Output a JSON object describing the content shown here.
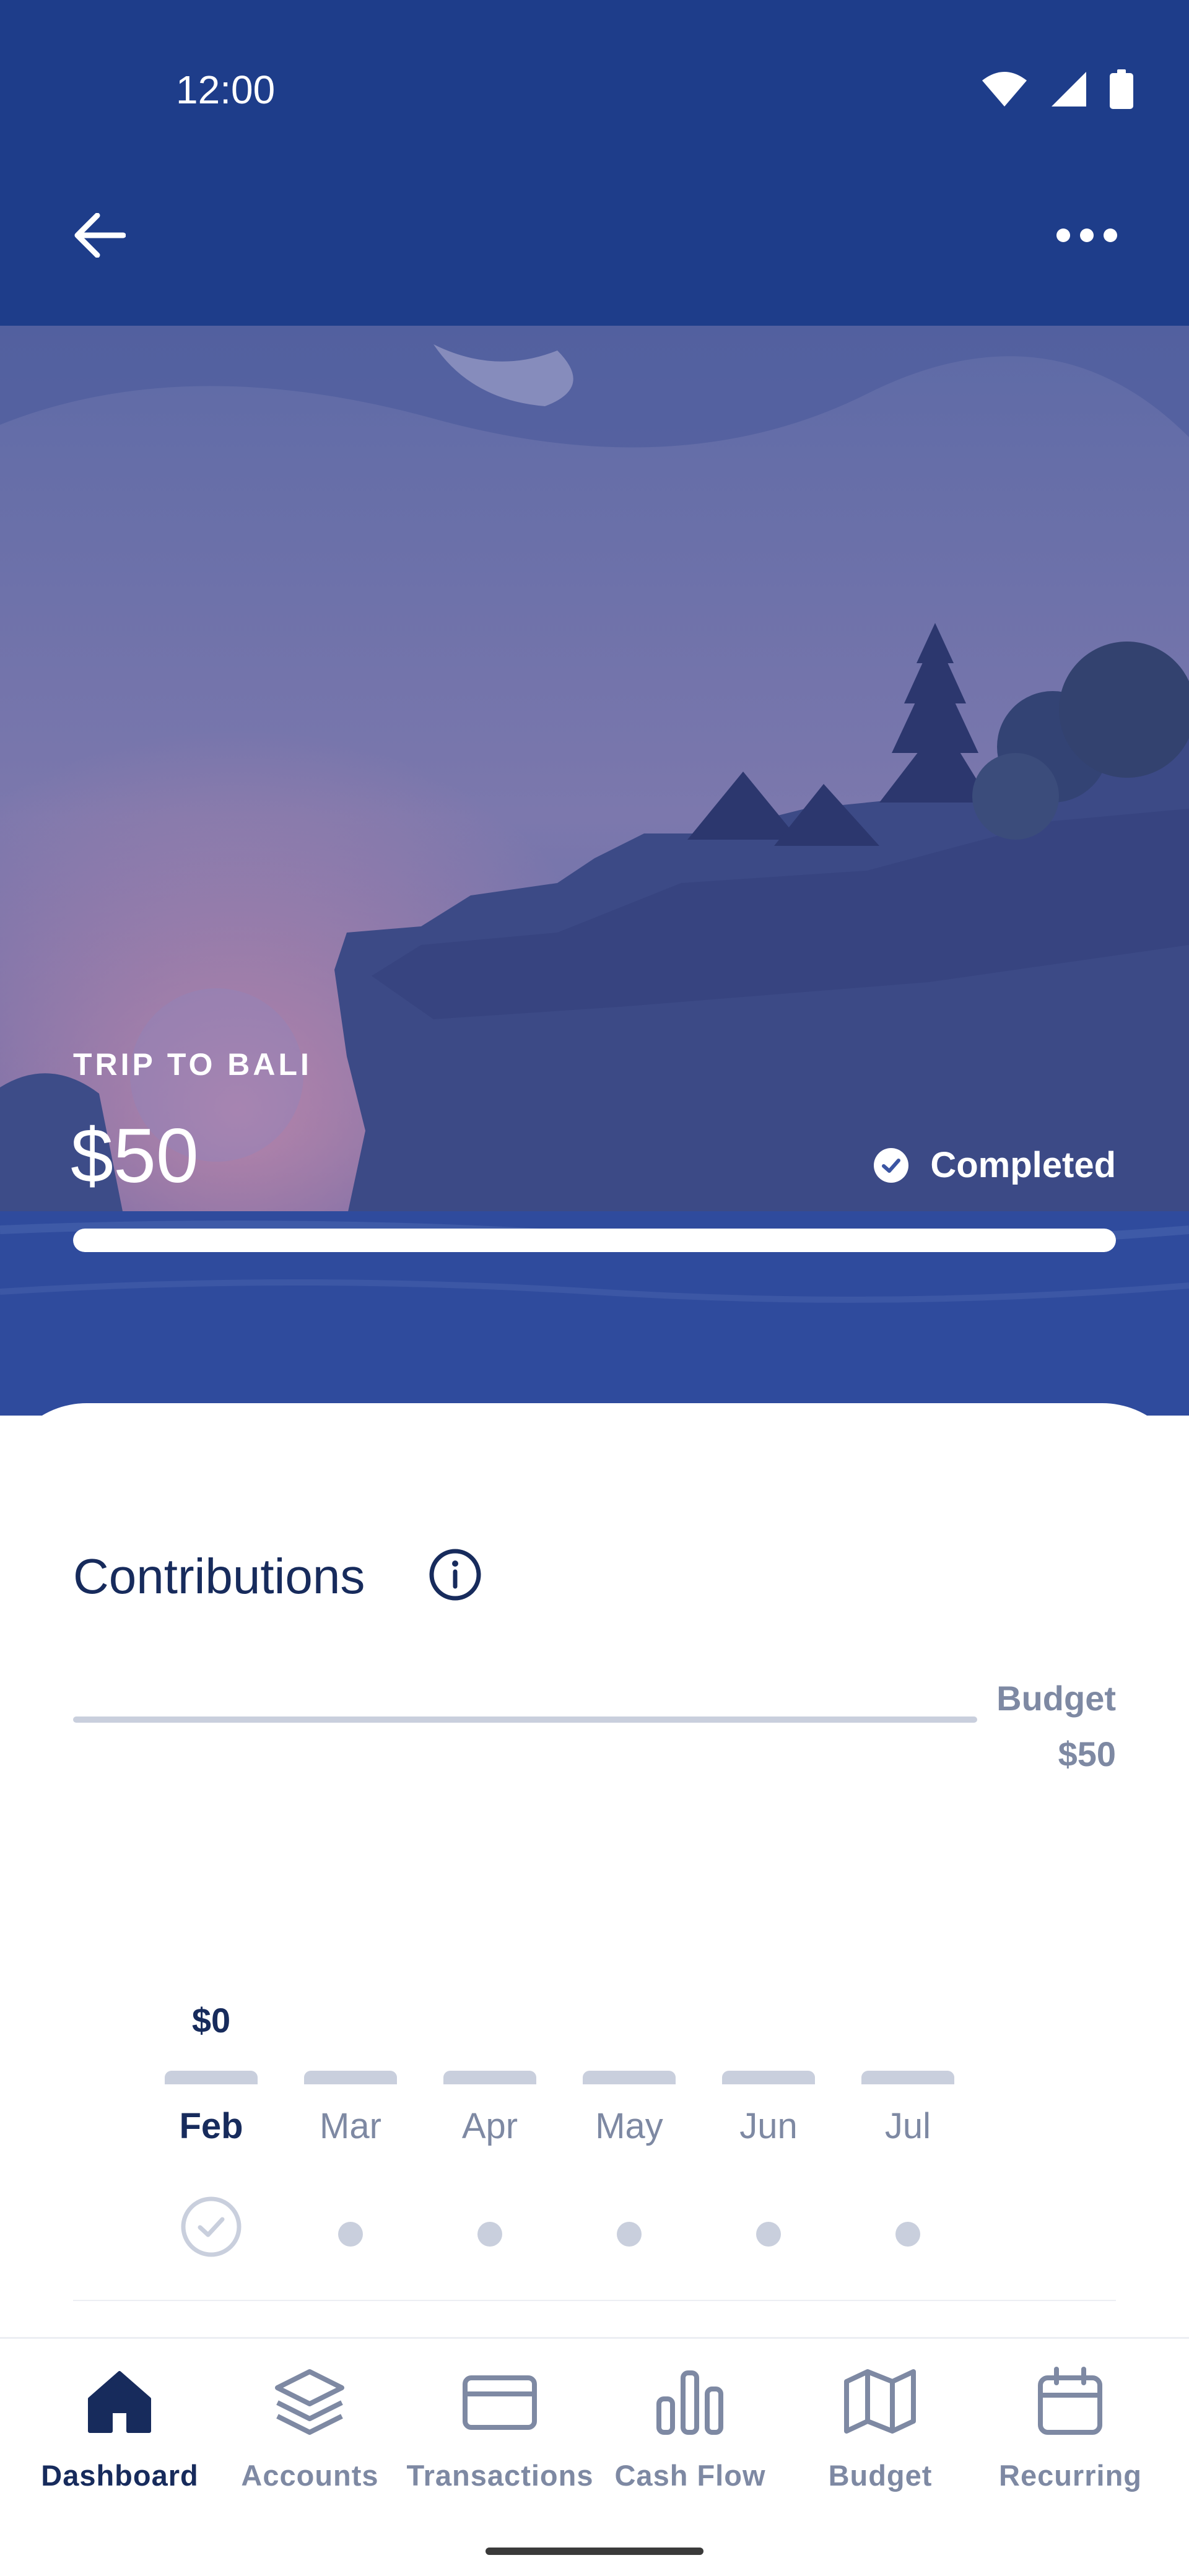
{
  "status_bar": {
    "time": "12:00",
    "icons": [
      "wifi-icon",
      "signal-icon",
      "battery-icon"
    ]
  },
  "app_bar": {
    "back_icon": "arrow-left-icon",
    "menu_icon": "more-horizontal-icon"
  },
  "goal": {
    "name": "TRIP TO BALI",
    "amount": "$50",
    "status": "Completed",
    "status_icon": "check-circle-icon",
    "progress": 1.0
  },
  "contributions": {
    "title": "Contributions",
    "info_icon": "info-icon",
    "budget_label": "Budget",
    "budget_value": "$50",
    "months": [
      {
        "label": "Feb",
        "value": "$0",
        "active": true,
        "done": true
      },
      {
        "label": "Mar",
        "value": "",
        "active": false,
        "done": false
      },
      {
        "label": "Apr",
        "value": "",
        "active": false,
        "done": false
      },
      {
        "label": "May",
        "value": "",
        "active": false,
        "done": false
      },
      {
        "label": "Jun",
        "value": "",
        "active": false,
        "done": false
      },
      {
        "label": "Jul",
        "value": "",
        "active": false,
        "done": false
      }
    ]
  },
  "bottom_nav": [
    {
      "label": "Dashboard",
      "icon": "home-icon",
      "active": true
    },
    {
      "label": "Accounts",
      "icon": "layers-icon",
      "active": false
    },
    {
      "label": "Transactions",
      "icon": "credit-card-icon",
      "active": false
    },
    {
      "label": "Cash Flow",
      "icon": "bar-chart-icon",
      "active": false
    },
    {
      "label": "Budget",
      "icon": "map-icon",
      "active": false
    },
    {
      "label": "Recurring",
      "icon": "calendar-icon",
      "active": false
    }
  ],
  "colors": {
    "primary": "#1e3d8a",
    "text_dark": "#172b5c",
    "muted": "#7e89a3",
    "track": "#c9cfdd"
  }
}
